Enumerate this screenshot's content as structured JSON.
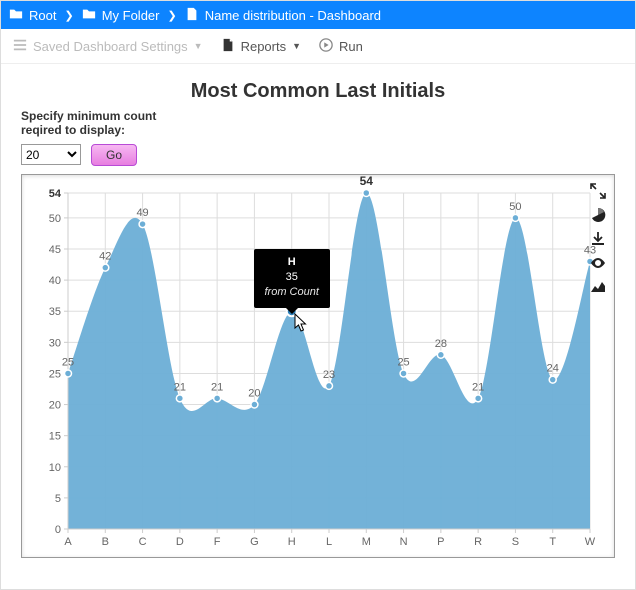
{
  "breadcrumb": [
    {
      "icon": "folder",
      "label": "Root"
    },
    {
      "icon": "folder",
      "label": "My Folder"
    },
    {
      "icon": "file",
      "label": "Name distribution - Dashboard"
    }
  ],
  "toolbar": {
    "saved_settings": "Saved Dashboard Settings",
    "reports": "Reports",
    "run": "Run"
  },
  "title": "Most Common Last Initials",
  "controls": {
    "label": "Specify minimum count reqired to display:",
    "select_value": "20",
    "go": "Go"
  },
  "tooltip": {
    "category": "H",
    "value": "35",
    "series": "from Count",
    "at_category": "H"
  },
  "chart_data": {
    "type": "area",
    "title": "Most Common Last Initials",
    "xlabel": "",
    "ylabel": "",
    "ylim": [
      0,
      54
    ],
    "y_ticks": [
      0,
      5,
      10,
      15,
      20,
      25,
      30,
      35,
      40,
      45,
      50,
      54
    ],
    "categories": [
      "A",
      "B",
      "C",
      "D",
      "F",
      "G",
      "H",
      "L",
      "M",
      "N",
      "P",
      "R",
      "S",
      "T",
      "W"
    ],
    "values": [
      25,
      42,
      49,
      21,
      21,
      20,
      35,
      23,
      54,
      25,
      28,
      21,
      50,
      24,
      43
    ],
    "highlight_index": 6,
    "series_name": "Count",
    "grid": true,
    "legend": false
  }
}
